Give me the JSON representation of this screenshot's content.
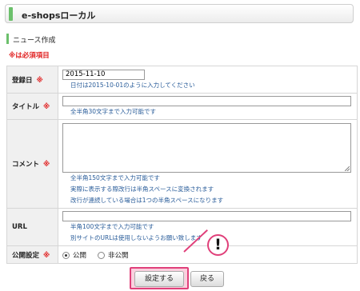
{
  "header": {
    "title": "e-shopsローカル"
  },
  "section": {
    "title": "ニュース作成"
  },
  "required_note": "※は必須項目",
  "required_mark": "※",
  "fields": {
    "date": {
      "label": "登録日",
      "value": "2015-11-10",
      "hint": "日付は2015-10-01のように入力してください"
    },
    "title": {
      "label": "タイトル",
      "value": "",
      "hint": "全半角30文字まで入力可能です"
    },
    "comment": {
      "label": "コメント",
      "value": "",
      "hints": [
        "全半角150文字まで入力可能です",
        "実際に表示する際改行は半角スペースに変換されます",
        "改行が連続している場合は1つの半角スペースになります"
      ]
    },
    "url": {
      "label": "URL",
      "value": "",
      "hints": [
        "半角100文字まで入力可能です",
        "別サイトのURLは使用しないようお願い致します"
      ]
    },
    "publish": {
      "label": "公開設定",
      "options": [
        {
          "label": "公開",
          "checked": true
        },
        {
          "label": "非公開",
          "checked": false
        }
      ]
    }
  },
  "buttons": {
    "save": "設定する",
    "back": "戻る"
  },
  "callout": {
    "symbol": "!"
  },
  "colors": {
    "accent_green": "#6cc06c",
    "required_red": "#e02020",
    "hint_blue": "#2a5d9a",
    "highlight_pink": "#e0407a"
  }
}
